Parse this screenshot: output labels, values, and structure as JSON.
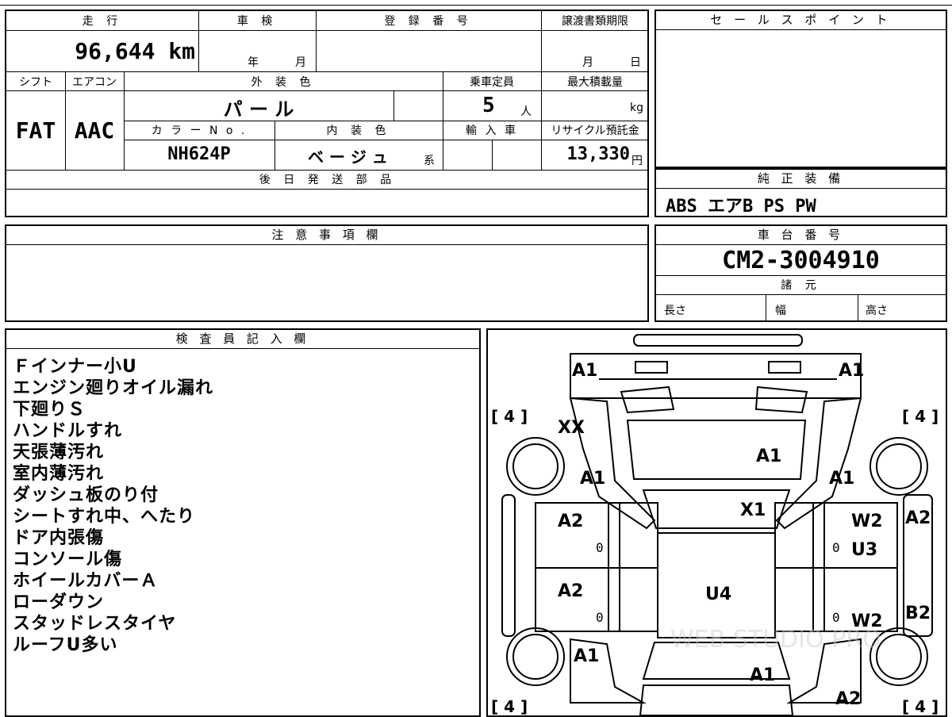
{
  "vehicle": {
    "mileage_label": "走 行",
    "mileage_value": "96,644 km",
    "shaken_label": "車 検",
    "shaken_year_unit": "年",
    "shaken_month_unit": "月",
    "reg_label": "登 録 番 号",
    "transfer_label": "譲渡書類期限",
    "transfer_month_unit": "月",
    "transfer_day_unit": "日",
    "shift_label": "シフト",
    "shift_value": "FAT",
    "ac_label": "エアコン",
    "ac_value": "AAC",
    "ext_color_label": "外 装 色",
    "ext_color_value": "パ ー ル",
    "capacity_label": "乗車定員",
    "capacity_value": "5",
    "capacity_unit": "人",
    "max_load_label": "最大積載量",
    "max_load_unit": "kg",
    "color_no_label": "カ ラ ー N o .",
    "color_no_value": "NH624P",
    "int_color_label": "内 装 色",
    "int_color_value": "ベ ー ジ ュ",
    "int_color_suffix": "系",
    "import_label": "輸 入 車",
    "recycle_label": "リサイクル預託金",
    "recycle_value": "13,330",
    "recycle_unit": "円",
    "later_parts_label": "後 日 発 送 部 品"
  },
  "sales": {
    "label": "セ ー ル ス ポ イ ン ト"
  },
  "equipment": {
    "label": "純 正 装 備",
    "value": "ABS エアB PS PW"
  },
  "caution": {
    "label": "注 意 事 項 欄"
  },
  "chassis": {
    "label": "車 台 番 号",
    "value": "CM2-3004910",
    "spec_label": "諸 元",
    "length_label": "長さ",
    "width_label": "幅",
    "height_label": "高さ"
  },
  "inspector": {
    "label": "検 査 員 記 入 欄",
    "notes": [
      "Ｆインナー小U",
      "エンジン廻りオイル漏れ",
      "下廻りＳ",
      "ハンドルすれ",
      "天張薄汚れ",
      "室内薄汚れ",
      "ダッシュ板のり付",
      "シートすれ中、へたり",
      "ドア内張傷",
      "コンソール傷",
      "ホイールカバーＡ",
      "ローダウン",
      "スタッドレスタイヤ",
      "ルーフU多い"
    ]
  },
  "diagram": {
    "marks": {
      "front_left": "A1",
      "front_right": "A1",
      "hood_left": "XX",
      "hood": "A1",
      "fender_left": "A1",
      "fender_right": "A1",
      "windshield": "X1",
      "door_fl": "A2",
      "door_fl_num": "0",
      "door_rl": "A2",
      "door_rl_num": "0",
      "roof": "U4",
      "door_fr": "W2",
      "door_fr_num": "0",
      "door_fr2": "U3",
      "door_rr": "W2",
      "door_rr_num": "0",
      "side_right_upper": "A2",
      "side_right_lower": "B2",
      "quarter_left": "A1",
      "rear": "A1",
      "quarter_right": "A2"
    },
    "tires": {
      "fl": "[ 4 ]",
      "fr": "[ 4 ]",
      "rl": "[ 4 ]",
      "rr": "[ 4 ]"
    },
    "watermark": "WEB STUDIO PRO"
  }
}
